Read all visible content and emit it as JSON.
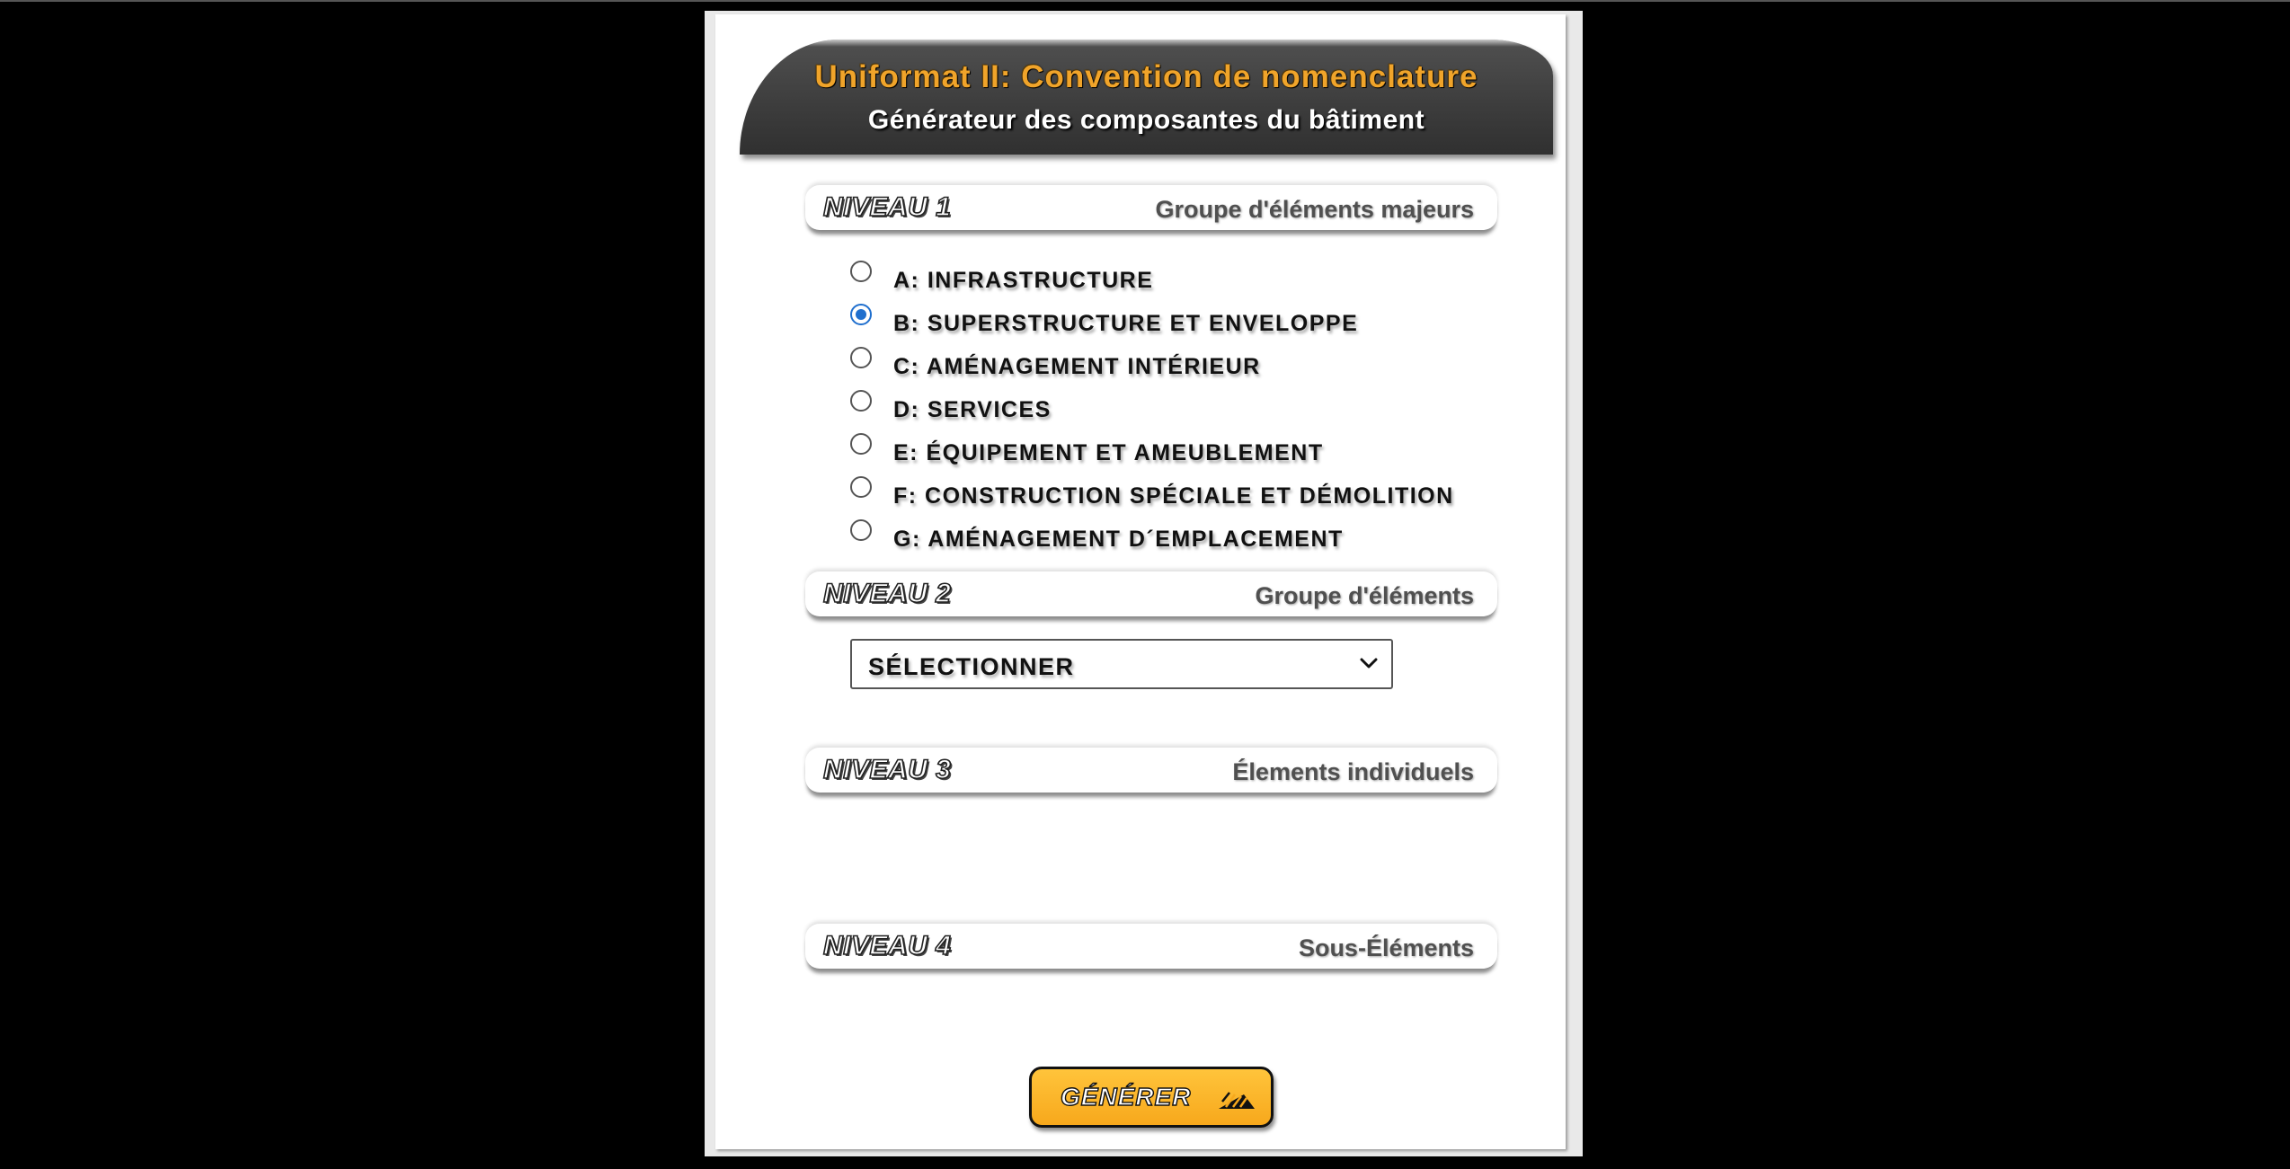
{
  "header": {
    "title": "Uniformat II: Convention de nomenclature",
    "subtitle": "Générateur des composantes du bâtiment",
    "title_color": "#f0a42a"
  },
  "levels": [
    {
      "label": "NIVEAU 1",
      "description": "Groupe d'éléments majeurs"
    },
    {
      "label": "NIVEAU 2",
      "description": "Groupe d'éléments"
    },
    {
      "label": "NIVEAU 3",
      "description": "Élements individuels"
    },
    {
      "label": "NIVEAU 4",
      "description": "Sous-Éléments"
    }
  ],
  "level1_options": [
    {
      "label": "A: INFRASTRUCTURE",
      "checked": false
    },
    {
      "label": "B: SUPERSTRUCTURE ET ENVELOPPE",
      "checked": true
    },
    {
      "label": "C: AMÉNAGEMENT INTÉRIEUR",
      "checked": false
    },
    {
      "label": "D: SERVICES",
      "checked": false
    },
    {
      "label": "E: ÉQUIPEMENT ET AMEUBLEMENT",
      "checked": false
    },
    {
      "label": "F: CONSTRUCTION SPÉCIALE ET DÉMOLITION",
      "checked": false
    },
    {
      "label": "G: AMÉNAGEMENT D´EMPLACEMENT",
      "checked": false
    }
  ],
  "level2_select": {
    "selected": "SÉLECTIONNER"
  },
  "generate_button": {
    "label": "GÉNÉRER",
    "color": "#f7a81c"
  },
  "icons": {
    "select_arrow": "chevron-down-icon",
    "generate_icon": "speed-lines-icon",
    "selected_radio_color": "#1f6fce"
  }
}
